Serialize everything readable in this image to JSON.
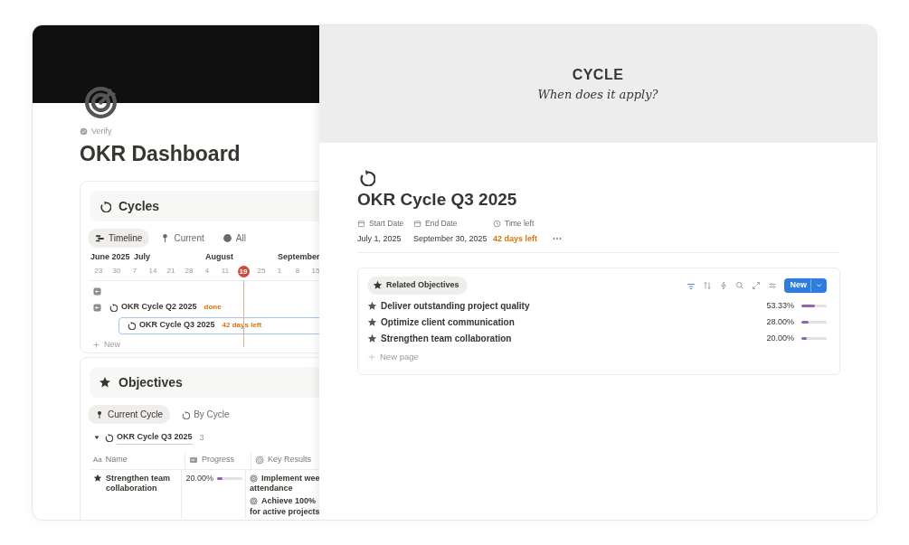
{
  "dashboard": {
    "verify": "Verify",
    "title": "OKR Dashboard"
  },
  "cycles": {
    "title": "Cycles",
    "views": [
      {
        "label": "Timeline",
        "selected": true
      },
      {
        "label": "Current",
        "selected": false
      },
      {
        "label": "All",
        "selected": false
      }
    ],
    "months": [
      "June 2025",
      "July",
      "August",
      "September"
    ],
    "weeks": [
      {
        "label": "23",
        "today": false
      },
      {
        "label": "30",
        "today": false
      },
      {
        "label": "7",
        "today": false
      },
      {
        "label": "14",
        "today": false
      },
      {
        "label": "21",
        "today": false
      },
      {
        "label": "28",
        "today": false
      },
      {
        "label": "4",
        "today": false
      },
      {
        "label": "11",
        "today": false
      },
      {
        "label": "19",
        "today": true
      },
      {
        "label": "25",
        "today": false
      },
      {
        "label": "1",
        "today": false
      },
      {
        "label": "8",
        "today": false
      },
      {
        "label": "15",
        "today": false
      }
    ],
    "rows": [
      {
        "name": "OKR Cycle Q2 2025",
        "status": "done",
        "selected": false
      },
      {
        "name": "OKR Cycle Q3 2025",
        "status": "42 days left",
        "selected": true
      }
    ],
    "new": "New"
  },
  "objectives": {
    "title": "Objectives",
    "views": [
      {
        "label": "Current Cycle",
        "selected": true
      },
      {
        "label": "By Cycle",
        "selected": false
      }
    ],
    "group": {
      "name": "OKR Cycle Q3 2025",
      "count": "3",
      "expanded": true
    },
    "columns": [
      {
        "label": "Name",
        "glyph": "Aa"
      },
      {
        "label": "Progress"
      },
      {
        "label": "Key Results"
      }
    ],
    "rows": [
      {
        "name": "Strengthen team collaboration",
        "progress": "20.00%",
        "level": 0.2,
        "key_results": [
          {
            "line": "Implement wee",
            "more": "attendance"
          },
          {
            "line": "Achieve 100%",
            "more": "for active projects"
          }
        ]
      }
    ]
  },
  "cycle_page": {
    "banner_title": "CYCLE",
    "banner_subtitle": "When does it apply?",
    "title": "OKR Cycle Q3 2025",
    "properties": [
      {
        "label": "Start Date",
        "kind": "date",
        "value": "July 1, 2025"
      },
      {
        "label": "End Date",
        "kind": "date",
        "value": "September 30, 2025"
      },
      {
        "label": "Time left",
        "kind": "countdown",
        "value": "42 days left"
      }
    ],
    "related": {
      "title": "Related Objectives",
      "filter_active": true,
      "new_button": "New",
      "items": [
        {
          "name": "Deliver outstanding project quality",
          "progress": "53.33%",
          "level": 0.5333
        },
        {
          "name": "Optimize client communication",
          "progress": "28.00%",
          "level": 0.28
        },
        {
          "name": "Strengthen team collaboration",
          "progress": "20.00%",
          "level": 0.2
        }
      ],
      "new_page": "New page"
    }
  }
}
